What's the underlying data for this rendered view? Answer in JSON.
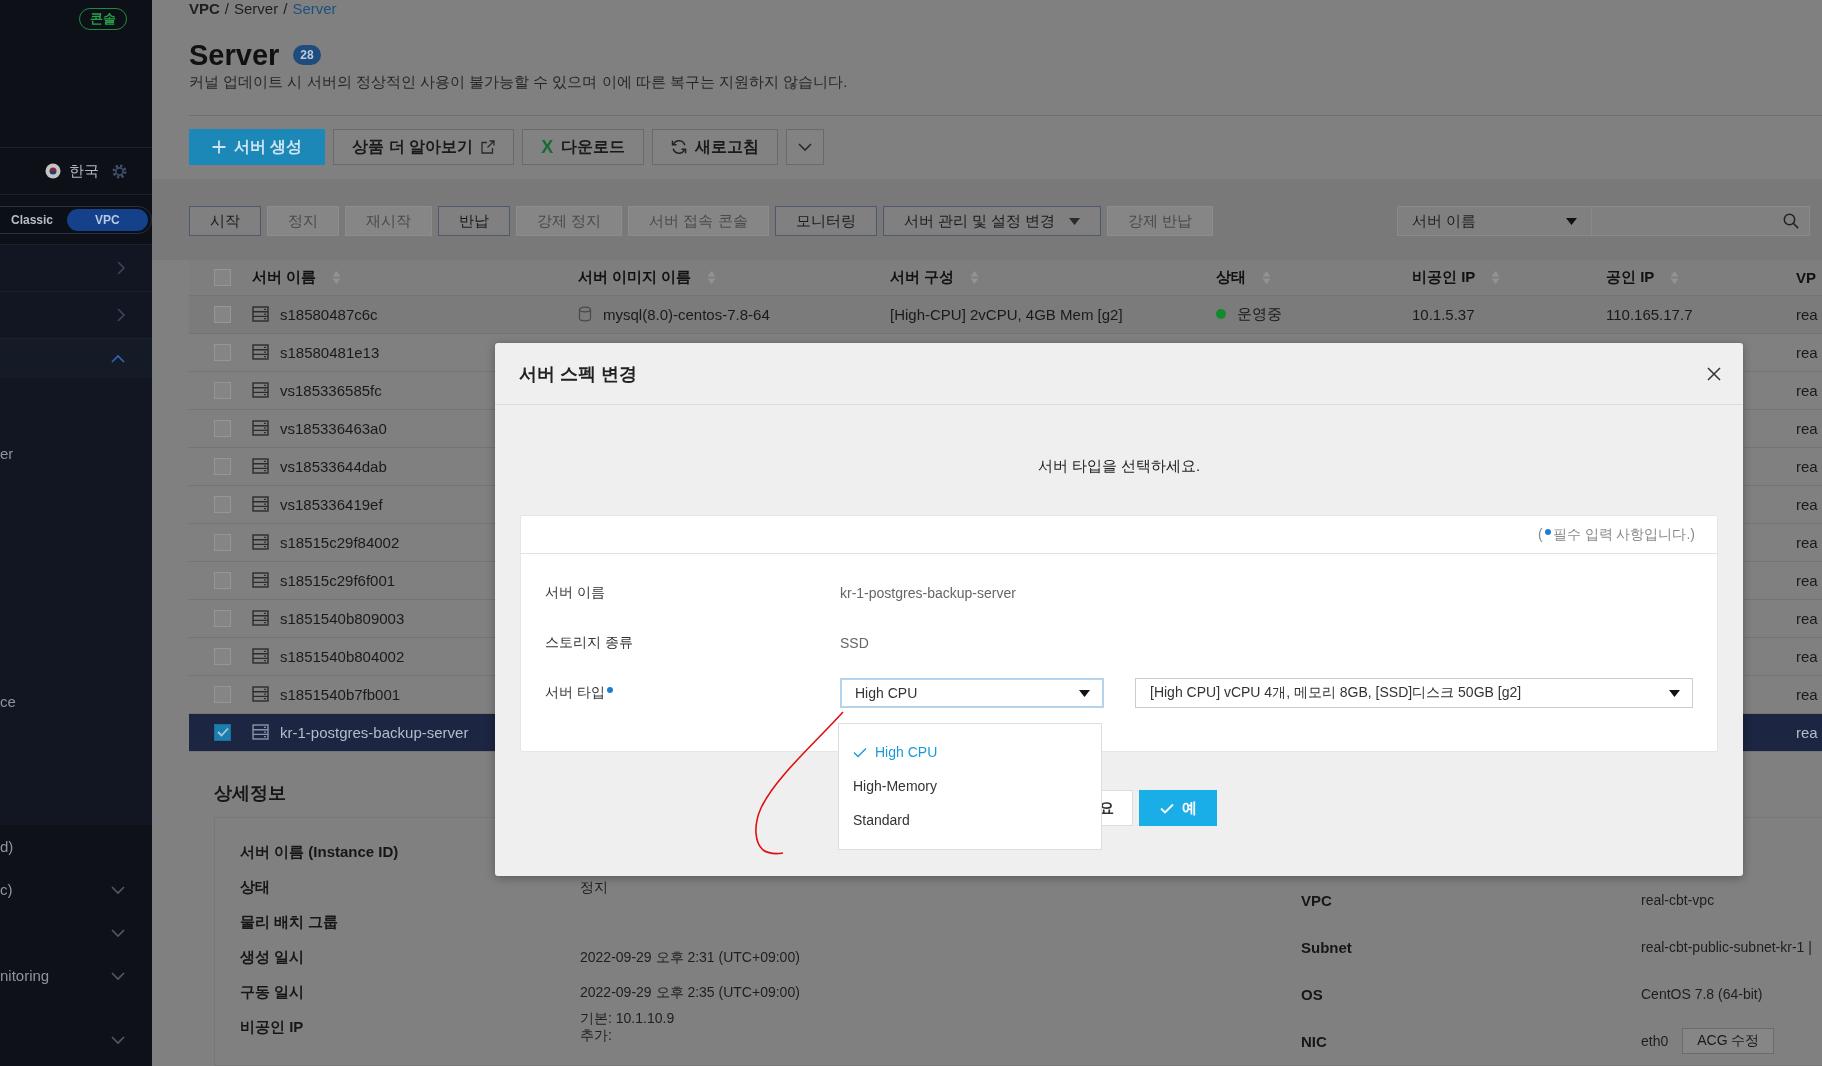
{
  "sidebar": {
    "badge": "콘솔",
    "language": "한국",
    "network": [
      {
        "label": "Classic",
        "selected": false
      },
      {
        "label": "VPC",
        "selected": true
      }
    ],
    "menu": [
      {
        "kind": "link"
      },
      {
        "kind": "link"
      },
      {
        "kind": "group",
        "expanded": true,
        "children": [
          {
            "label": "er"
          },
          {
            "label": "ce"
          }
        ]
      }
    ],
    "lower_menu": [
      {
        "kind": "text",
        "label": "d)"
      },
      {
        "kind": "group",
        "label": "c)",
        "expanded": false
      },
      {
        "kind": "group",
        "expanded": false
      },
      {
        "kind": "group",
        "label": "nitoring",
        "expanded": false
      },
      {
        "kind": "group",
        "expanded": false
      }
    ]
  },
  "breadcrumb": [
    {
      "label": "VPC",
      "separator": "/",
      "current": false
    },
    {
      "label": "Server",
      "separator": "/",
      "current": false
    },
    {
      "label": "Server",
      "current": true
    }
  ],
  "page": {
    "title": "Server",
    "count": "28",
    "description": "커널 업데이트 시 서버의 정상적인 사용이 불가능할 수 있으며 이에 따른 복구는 지원하지 않습니다."
  },
  "toolbar": [
    {
      "kind": "primary",
      "label": "서버 생성"
    },
    {
      "kind": "default",
      "label": "상품 더 알아보기"
    },
    {
      "kind": "default",
      "glyph": "X",
      "label": "다운로드"
    },
    {
      "kind": "default",
      "label": "새로고침"
    },
    {
      "kind": "menu"
    }
  ],
  "actions": [
    {
      "label": "시작",
      "disabled": false,
      "kind": "button"
    },
    {
      "label": "정지",
      "disabled": true,
      "kind": "button"
    },
    {
      "label": "재시작",
      "disabled": true,
      "kind": "button"
    },
    {
      "label": "반납",
      "disabled": false,
      "kind": "button"
    },
    {
      "label": "강제 정지",
      "disabled": true,
      "kind": "button"
    },
    {
      "label": "서버 접속 콘솔",
      "disabled": true,
      "kind": "button"
    },
    {
      "label": "모니터링",
      "disabled": false,
      "kind": "button"
    },
    {
      "label": "서버 관리 및 설정 변경",
      "disabled": false,
      "kind": "dropdown"
    },
    {
      "label": "강제 반납",
      "disabled": true,
      "kind": "button"
    }
  ],
  "filter": {
    "field": "서버 이름"
  },
  "table": {
    "select_all": {
      "checked": false
    },
    "columns": [
      {
        "label": "서버 이름",
        "sortable": true
      },
      {
        "label": "서버 이미지 이름",
        "sortable": true
      },
      {
        "label": "서버 구성",
        "sortable": true
      },
      {
        "label": "상태",
        "sortable": true
      },
      {
        "label": "비공인 IP",
        "sortable": true
      },
      {
        "label": "공인 IP",
        "sortable": true
      },
      {
        "label": "VP"
      }
    ],
    "rows": [
      {
        "checked": false,
        "selected": false,
        "name": "s18580487c6c",
        "image": "mysql(8.0)-centos-7.8-64",
        "spec": "[High-CPU] 2vCPU, 4GB Mem [g2]",
        "status": "운영중",
        "color": "#148a2e",
        "private_ip": "10.1.5.37",
        "public_ip": "110.165.17.7",
        "vpc": "rea"
      },
      {
        "checked": false,
        "selected": false,
        "name": "s18580481e13",
        "vpc": "rea"
      },
      {
        "checked": false,
        "selected": false,
        "name": "vs185336585fc",
        "vpc": "rea"
      },
      {
        "checked": false,
        "selected": false,
        "name": "vs185336463a0",
        "vpc": "rea"
      },
      {
        "checked": false,
        "selected": false,
        "name": "vs18533644dab",
        "vpc": "rea"
      },
      {
        "checked": false,
        "selected": false,
        "name": "vs185336419ef",
        "vpc": "rea"
      },
      {
        "checked": false,
        "selected": false,
        "name": "s18515c29f84002",
        "vpc": "rea"
      },
      {
        "checked": false,
        "selected": false,
        "name": "s18515c29f6f001",
        "vpc": "rea"
      },
      {
        "checked": false,
        "selected": false,
        "name": "s1851540b809003",
        "vpc": "rea"
      },
      {
        "checked": false,
        "selected": false,
        "name": "s1851540b804002",
        "vpc": "rea"
      },
      {
        "checked": false,
        "selected": false,
        "name": "s1851540b7fb001",
        "vpc": "rea"
      },
      {
        "checked": true,
        "selected": true,
        "name": "kr-1-postgres-backup-server",
        "vpc": "rea"
      }
    ]
  },
  "details": {
    "title": "상세정보",
    "left": [
      {
        "label": "서버 이름 (Instance ID)"
      },
      {
        "label": "상태",
        "value": "정지"
      },
      {
        "label": "물리 배치 그룹"
      },
      {
        "label": "생성 일시",
        "value": "2022-09-29 오후 2:31 (UTC+09:00)"
      },
      {
        "label": "구동 일시",
        "value": "2022-09-29 오후 2:35 (UTC+09:00)"
      },
      {
        "label": "비공인 IP",
        "value": "기본: 10.1.10.9",
        "extra": "추가:"
      }
    ],
    "right": [
      {
        "label": "VPC",
        "value": "real-cbt-vpc"
      },
      {
        "label": "Subnet",
        "value": "real-cbt-public-subnet-kr-1 |"
      },
      {
        "label": "OS",
        "value": "CentOS 7.8 (64-bit)"
      },
      {
        "label": "NIC",
        "value": "eth0",
        "action": "ACG 수정"
      }
    ]
  },
  "modal": {
    "title": "서버 스펙 변경",
    "prompt": "서버 타입을 선택하세요.",
    "required_note": {
      "open": "(",
      "text": "필수 입력 사항입니다.)"
    },
    "fields": [
      {
        "kind": "text",
        "label": "서버 이름",
        "value": "kr-1-postgres-backup-server"
      },
      {
        "kind": "text",
        "label": "스토리지 종류",
        "value": "SSD"
      },
      {
        "kind": "select",
        "label": "서버 타입",
        "required": true,
        "type_select": {
          "value": "High CPU",
          "focused": true,
          "expanded": true,
          "options": [
            {
              "label": "High CPU",
              "selected": true
            },
            {
              "label": "High-Memory",
              "selected": false
            },
            {
              "label": "Standard",
              "selected": false
            }
          ]
        },
        "spec_select": {
          "value": "[High CPU] vCPU 4개, 메모리 8GB, [SSD]디스크 50GB [g2]"
        }
      }
    ],
    "buttons": [
      {
        "kind": "cancel",
        "label": "요"
      },
      {
        "kind": "confirm",
        "label": "예"
      }
    ]
  }
}
